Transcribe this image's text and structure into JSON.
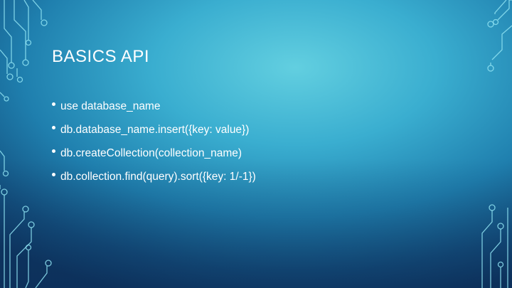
{
  "slide": {
    "title": "BASICS API",
    "bullets": [
      "use database_name",
      "db.database_name.insert({key: value})",
      "db.createCollection(collection_name)",
      "db.collection.find(query).sort({key: 1/-1})"
    ]
  },
  "theme": {
    "background_colors": [
      "#62cfe0",
      "#1f7fae",
      "#0e3a66"
    ],
    "text_color": "#ffffff",
    "circuit_color": "#8fe3f2"
  }
}
